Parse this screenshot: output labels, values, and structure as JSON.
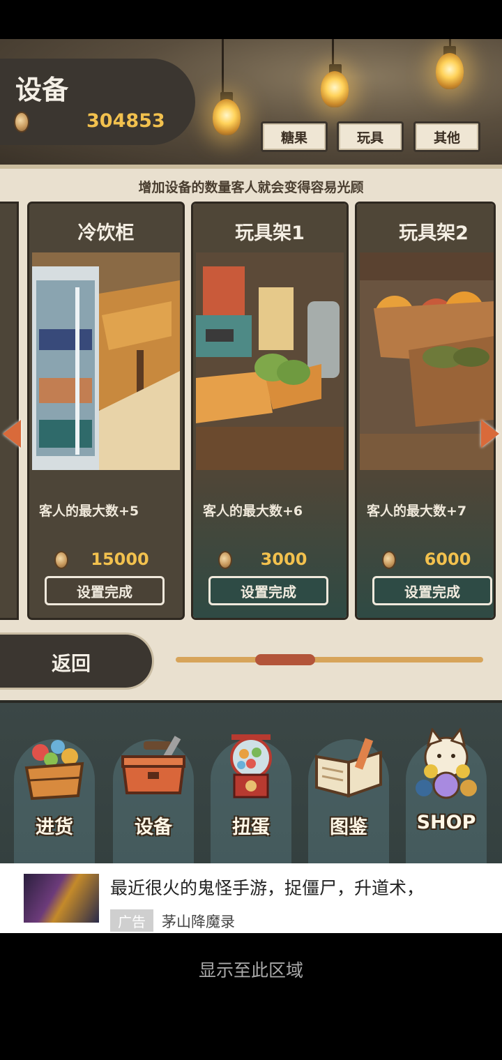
{
  "header": {
    "title": "设备",
    "money": "304853",
    "tabs": [
      "糖果",
      "玩具",
      "其他"
    ]
  },
  "hint": "增加设备的数量客人就会变得容易光顾",
  "cards": [
    {
      "title": "冷饮柜",
      "desc": "客人的最大数+5",
      "price": "15000",
      "button": "设置完成",
      "image": "cold-drink-cabinet"
    },
    {
      "title": "玩具架1",
      "desc": "客人的最大数+6",
      "price": "3000",
      "button": "设置完成",
      "image": "toy-shelf"
    },
    {
      "title": "玩具架2",
      "desc": "客人的最大数+7",
      "price": "6000",
      "button": "设置完成",
      "image": "toy-shelf-balls"
    }
  ],
  "back_label": "返回",
  "nav": [
    {
      "label": "进货",
      "icon": "goods-basket-icon"
    },
    {
      "label": "设备",
      "icon": "toolbox-icon"
    },
    {
      "label": "扭蛋",
      "icon": "gacha-machine-icon"
    },
    {
      "label": "图鉴",
      "icon": "book-icon"
    },
    {
      "label": "SHOP",
      "icon": "lucky-cat-icon"
    }
  ],
  "ad": {
    "text": "最近很火的鬼怪手游，捉僵尸，升道术，",
    "tag": "广告",
    "source": "茅山降魔录"
  },
  "footer_text": "显示至此区域",
  "colors": {
    "accent_gold": "#f2c14e",
    "arrow": "#d96a3a",
    "scroll_thumb": "#b3553a"
  }
}
